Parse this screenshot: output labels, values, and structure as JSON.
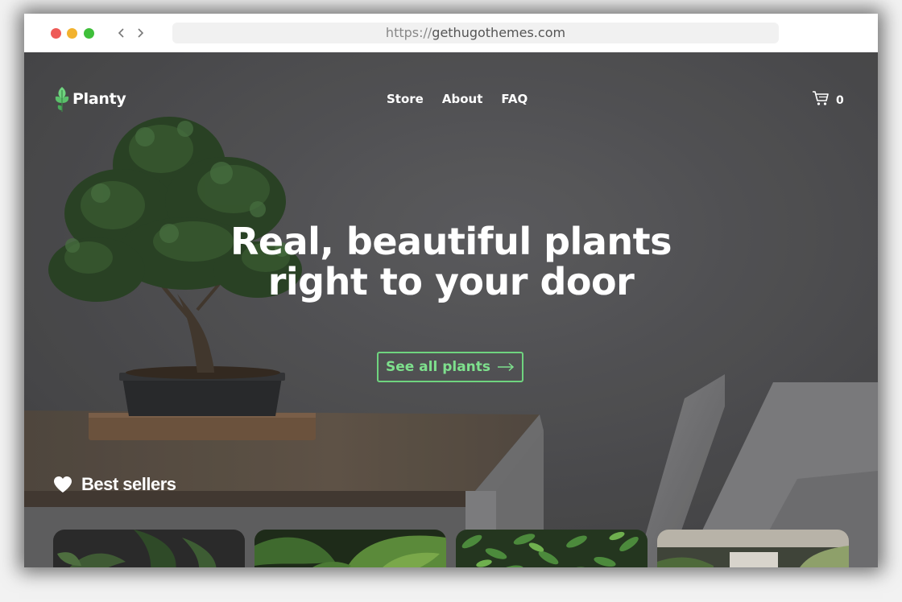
{
  "browser": {
    "url_protocol": "https://",
    "url_domain": "gethugothemes.com"
  },
  "brand": {
    "name": "Planty",
    "accent_color": "#6fd47f"
  },
  "nav": {
    "items": [
      {
        "label": "Store"
      },
      {
        "label": "About"
      },
      {
        "label": "FAQ"
      }
    ]
  },
  "cart": {
    "count": "0",
    "icon": "cart-icon"
  },
  "hero": {
    "headline_line1": "Real, beautiful plants",
    "headline_line2": "right to your door",
    "cta_label": "See all plants",
    "cta_icon": "arrow-right-icon"
  },
  "best_sellers": {
    "title": "Best sellers",
    "icon": "heart-icon",
    "cards": [
      {
        "name": "product-card-1"
      },
      {
        "name": "product-card-2"
      },
      {
        "name": "product-card-3"
      },
      {
        "name": "product-card-4"
      }
    ]
  }
}
